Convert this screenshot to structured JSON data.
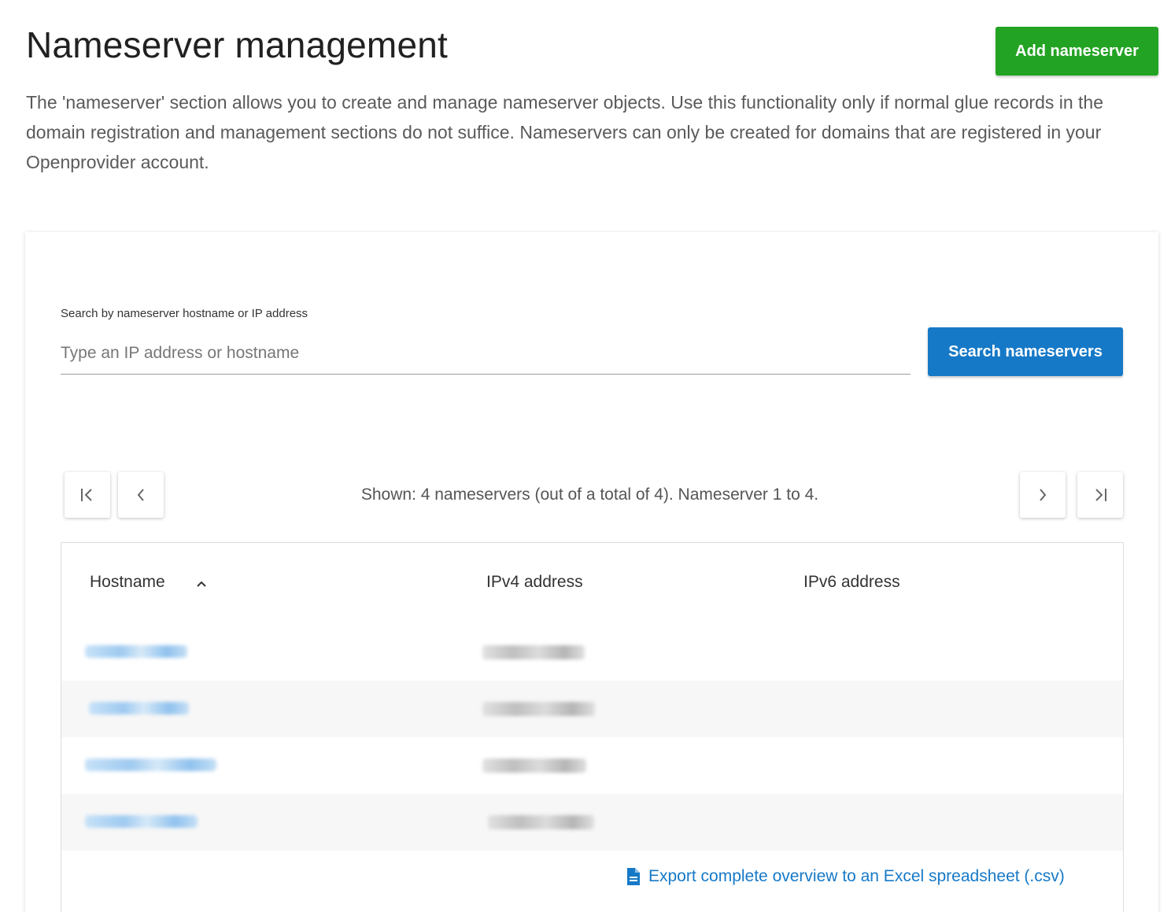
{
  "header": {
    "title": "Nameserver management",
    "add_button_label": "Add nameserver",
    "description": "The 'nameserver' section allows you to create and manage nameserver objects. Use this functionality only if normal glue records in the domain registration and management sections do not suffice. Nameservers can only be created for domains that are registered in your Openprovider account."
  },
  "search": {
    "label": "Search by nameserver hostname or IP address",
    "placeholder": "Type an IP address or hostname",
    "value": "",
    "button_label": "Search nameservers"
  },
  "pagination": {
    "summary": "Shown: 4 nameservers (out of a total of 4). Nameserver 1 to 4.",
    "icons": [
      "first-page-icon",
      "previous-page-icon",
      "next-page-icon",
      "last-page-icon"
    ]
  },
  "table": {
    "columns": [
      "Hostname",
      "IPv4 address",
      "IPv6 address"
    ],
    "sort_column": "Hostname",
    "sort_direction": "ascending",
    "rows_count_shown": 4
  },
  "export": {
    "label": "Export complete overview to an Excel spreadsheet (.csv)",
    "icon": "document-icon"
  },
  "colors": {
    "add_button": "#23a323",
    "search_button": "#1679c7",
    "link": "#1679c7"
  }
}
